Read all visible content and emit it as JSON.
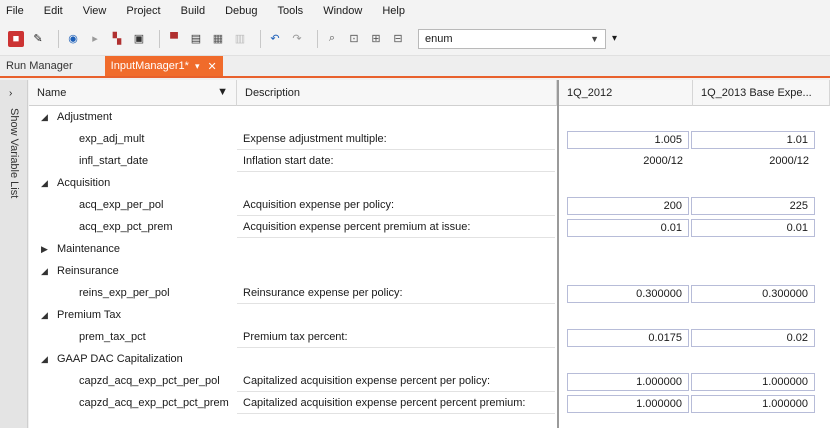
{
  "menu": [
    "File",
    "Edit",
    "View",
    "Project",
    "Build",
    "Debug",
    "Tools",
    "Window",
    "Help"
  ],
  "toolbar": {
    "combo_value": "enum",
    "icons": [
      "save-icon",
      "pin-icon",
      "back-icon",
      "forward-icon",
      "open-icon",
      "stop-icon",
      "build-icon",
      "save-all-icon",
      "undo-icon",
      "redo-icon",
      "find-icon"
    ]
  },
  "tabs": {
    "run_manager": "Run Manager",
    "input_manager": "InputManager1*",
    "close_glyph": "✕",
    "pin_glyph": "▾"
  },
  "side_panel": {
    "arrow": "›",
    "label": "Show Variable List"
  },
  "columns": {
    "name": "Name",
    "description": "Description",
    "col1": "1Q_2012",
    "col2": "1Q_2013 Base Expe..."
  },
  "rows": [
    {
      "kind": "group",
      "name": "Adjustment",
      "expanded": true
    },
    {
      "kind": "var",
      "name": "exp_adj_mult",
      "desc": "Expense adjustment multiple:",
      "v1": "1.005",
      "v2": "1.01",
      "boxed": true
    },
    {
      "kind": "var",
      "name": "infl_start_date",
      "desc": "Inflation start date:",
      "v1": "2000/12",
      "v2": "2000/12",
      "boxed": false
    },
    {
      "kind": "group",
      "name": "Acquisition",
      "expanded": true
    },
    {
      "kind": "var",
      "name": "acq_exp_per_pol",
      "desc": "Acquisition expense per policy:",
      "v1": "200",
      "v2": "225",
      "boxed": true
    },
    {
      "kind": "var",
      "name": "acq_exp_pct_prem",
      "desc": "Acquisition expense percent premium at issue:",
      "v1": "0.01",
      "v2": "0.01",
      "boxed": true
    },
    {
      "kind": "group",
      "name": "Maintenance",
      "expanded": false
    },
    {
      "kind": "group",
      "name": "Reinsurance",
      "expanded": true
    },
    {
      "kind": "var",
      "name": "reins_exp_per_pol",
      "desc": "Reinsurance expense per policy:",
      "v1": "0.300000",
      "v2": "0.300000",
      "boxed": true
    },
    {
      "kind": "group",
      "name": "Premium Tax",
      "expanded": true
    },
    {
      "kind": "var",
      "name": "prem_tax_pct",
      "desc": "Premium tax percent:",
      "v1": "0.0175",
      "v2": "0.02",
      "boxed": true
    },
    {
      "kind": "group",
      "name": "GAAP DAC Capitalization",
      "expanded": true
    },
    {
      "kind": "var",
      "name": "capzd_acq_exp_pct_per_pol",
      "desc": "Capitalized acquisition expense percent per policy:",
      "v1": "1.000000",
      "v2": "1.000000",
      "boxed": true
    },
    {
      "kind": "var",
      "name": "capzd_acq_exp_pct_pct_prem",
      "desc": "Capitalized acquisition expense percent percent premium:",
      "v1": "1.000000",
      "v2": "1.000000",
      "boxed": true
    }
  ]
}
